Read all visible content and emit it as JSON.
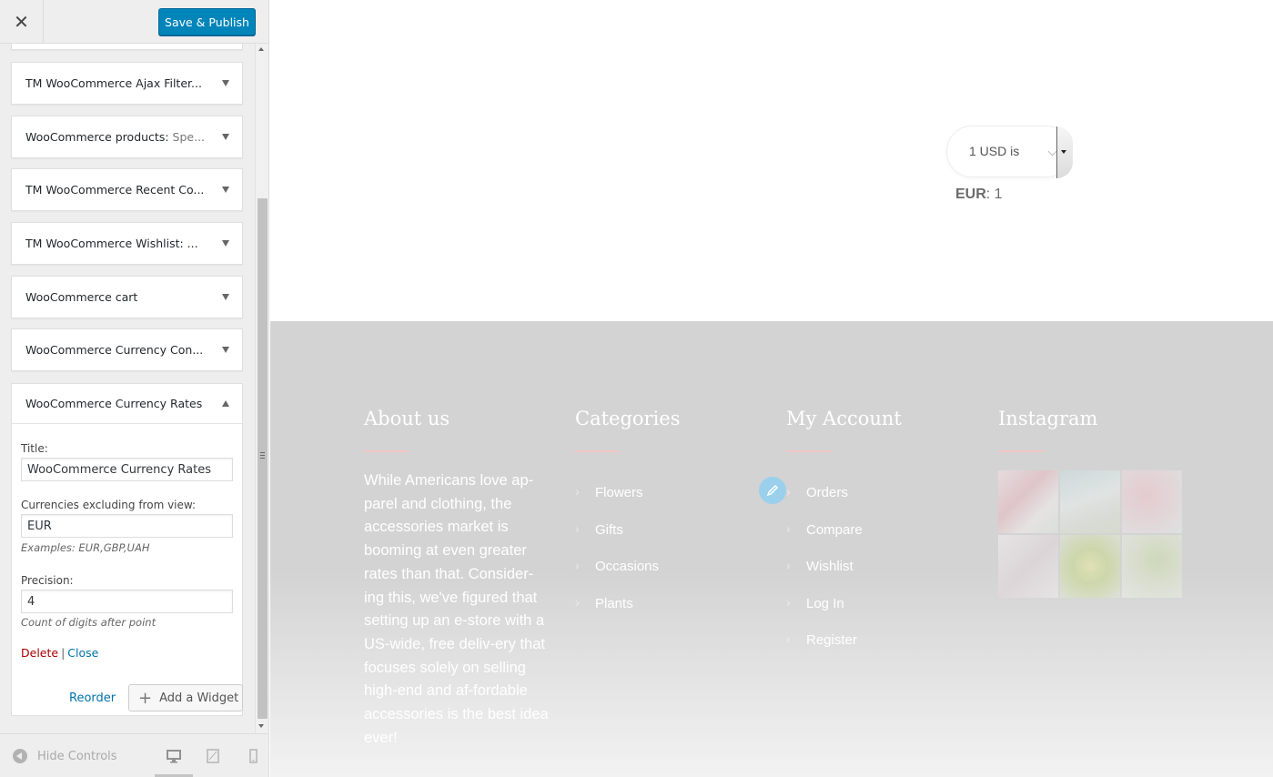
{
  "topbar": {
    "close_glyph": "✕",
    "publish_label": "Save & Publish"
  },
  "widgets": [
    {
      "title": "TM WooCommerce Ajax Filter...",
      "subtitle": ""
    },
    {
      "title": "WooCommerce products: ",
      "subtitle": "Spe..."
    },
    {
      "title": "TM WooCommerce Recent Co...",
      "subtitle": ""
    },
    {
      "title": "TM WooCommerce Wishlist: ...",
      "subtitle": ""
    },
    {
      "title": "WooCommerce cart",
      "subtitle": ""
    },
    {
      "title": "WooCommerce Currency Con...",
      "subtitle": ""
    }
  ],
  "expanded_widget": {
    "title": "WooCommerce Currency Rates",
    "fields": {
      "title_label": "Title:",
      "title_value": "WooCommerce Currency Rates",
      "exclude_label": "Currencies excluding from view:",
      "exclude_value": "EUR",
      "exclude_desc": "Examples: EUR,GBP,UAH",
      "precision_label": "Precision:",
      "precision_value": "4",
      "precision_desc": "Count of digits after point"
    },
    "delete_label": "Delete",
    "separator": "|",
    "close_label": "Close"
  },
  "actions": {
    "reorder_label": "Reorder",
    "add_widget_label": "Add a Widget"
  },
  "footer_controls": {
    "hide_controls_label": "Hide Controls",
    "devices": [
      "desktop-icon",
      "tablet-icon",
      "mobile-icon"
    ]
  },
  "preview": {
    "rates_select_value": "1 USD is",
    "rate_currency": "EUR",
    "rate_value": ": 1",
    "footer": {
      "about_heading": "About us",
      "about_text": "While Americans love ap-parel and clothing, the accessories market is booming at even greater rates than that. Consider-ing this, we've figured that setting up an e-store with a US-wide, free deliv-ery that focuses solely on selling high-end and af-fordable accessories is the best idea ever!",
      "categories_heading": "Categories",
      "categories": [
        "Flowers",
        "Gifts",
        "Occasions",
        "Plants"
      ],
      "account_heading": "My Account",
      "account": [
        "Orders",
        "Compare",
        "Wishlist",
        "Log In",
        "Register"
      ],
      "instagram_heading": "Instagram"
    }
  },
  "colors": {
    "primary_blue": "#0085ba",
    "link_blue": "#0073aa",
    "delete_red": "#aa0000",
    "footer_gray": "#d3d3d3",
    "underline_pink": "#f3c6c6",
    "pencil_blue": "#9ad0ec"
  }
}
